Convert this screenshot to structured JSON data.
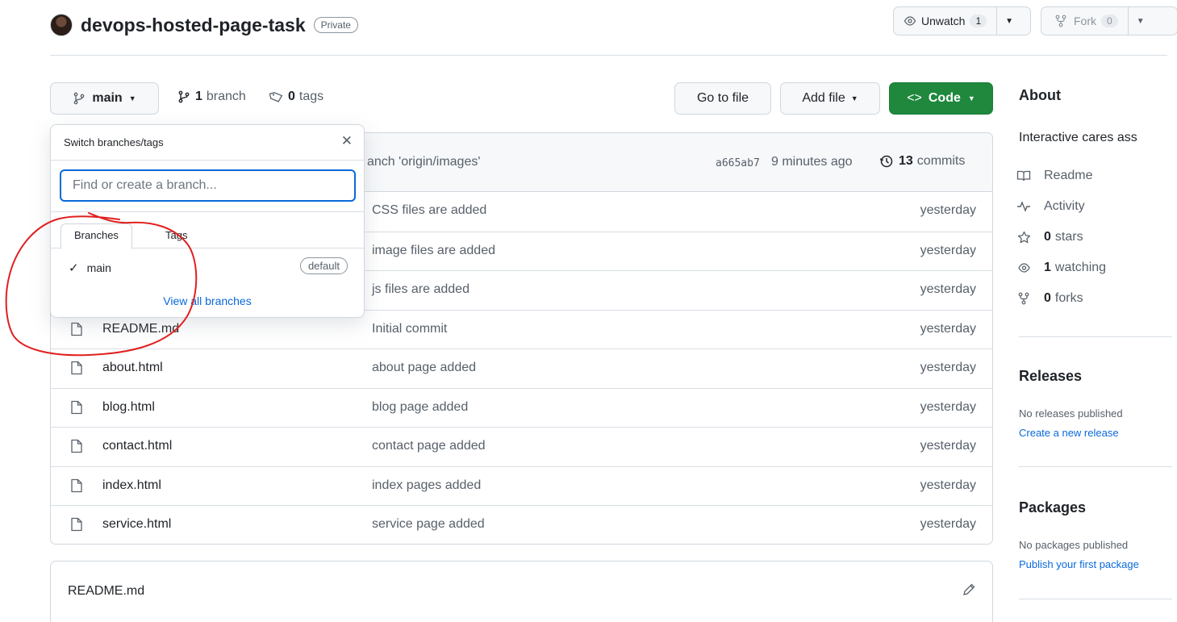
{
  "repo": {
    "name": "devops-hosted-page-task",
    "visibility": "Private",
    "unwatch_label": "Unwatch",
    "watch_count": "1",
    "fork_label": "Fork",
    "fork_count": "0"
  },
  "toolbar": {
    "branch_label": "main",
    "branches_count": "1",
    "branches_label": "branch",
    "tags_count": "0",
    "tags_label": "tags",
    "go_to_file": "Go to file",
    "add_file": "Add file",
    "code": "Code"
  },
  "commit": {
    "message_fragment": "anch 'origin/images'",
    "hash": "a665ab7",
    "time": "9 minutes ago",
    "commits_count": "13",
    "commits_label": "commits"
  },
  "files": [
    {
      "name": "",
      "message": "CSS files are added",
      "time": "yesterday"
    },
    {
      "name": "",
      "message": "image files are added",
      "time": "yesterday"
    },
    {
      "name": "",
      "message": "js files are added",
      "time": "yesterday"
    },
    {
      "name": "README.md",
      "message": "Initial commit",
      "time": "yesterday"
    },
    {
      "name": "about.html",
      "message": "about page added",
      "time": "yesterday"
    },
    {
      "name": "blog.html",
      "message": "blog page added",
      "time": "yesterday"
    },
    {
      "name": "contact.html",
      "message": "contact page added",
      "time": "yesterday"
    },
    {
      "name": "index.html",
      "message": "index pages added",
      "time": "yesterday"
    },
    {
      "name": "service.html",
      "message": "service page added",
      "time": "yesterday"
    }
  ],
  "readme": {
    "title": "README.md"
  },
  "dropdown": {
    "title": "Switch branches/tags",
    "placeholder": "Find or create a branch...",
    "tab_branches": "Branches",
    "tab_tags": "Tags",
    "branch_name": "main",
    "default_badge": "default",
    "view_all": "View all branches"
  },
  "sidebar": {
    "about_title": "About",
    "description": "Interactive cares ass",
    "readme": "Readme",
    "activity": "Activity",
    "stars_count": "0",
    "stars_label": "stars",
    "watching_count": "1",
    "watching_label": "watching",
    "forks_count": "0",
    "forks_label": "forks",
    "releases_title": "Releases",
    "no_releases": "No releases published",
    "create_release": "Create a new release",
    "packages_title": "Packages",
    "no_packages": "No packages published",
    "publish_package": "Publish your first package"
  },
  "colors": {
    "accent_blue": "#0969da",
    "code_green": "#1f883d",
    "annotation_red": "#e02020"
  }
}
